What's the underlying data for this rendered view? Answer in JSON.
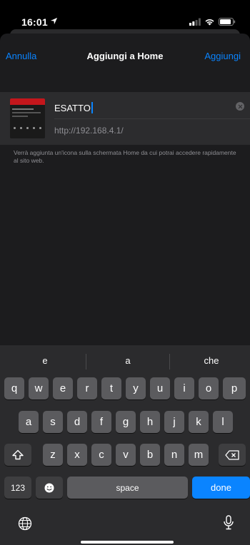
{
  "status_bar": {
    "time": "16:01"
  },
  "nav": {
    "cancel_label": "Annulla",
    "title": "Aggiungi a Home",
    "add_label": "Aggiungi"
  },
  "bookmark": {
    "name_value": "ESATTO",
    "url": "http://192.168.4.1/"
  },
  "hint_text": "Verrà aggiunta un'icona sulla schermata Home da cui potrai accedere rapidamente al sito web.",
  "keyboard": {
    "suggestions": [
      "e",
      "a",
      "che"
    ],
    "row1": [
      "q",
      "w",
      "e",
      "r",
      "t",
      "y",
      "u",
      "i",
      "o",
      "p"
    ],
    "row2": [
      "a",
      "s",
      "d",
      "f",
      "g",
      "h",
      "j",
      "k",
      "l"
    ],
    "row3": [
      "z",
      "x",
      "c",
      "v",
      "b",
      "n",
      "m"
    ],
    "numbers_label": "123",
    "space_label": "space",
    "done_label": "done"
  },
  "colors": {
    "accent": "#0a84ff",
    "sheet_background": "#1c1c1e",
    "keyboard_background": "#2b2b2d"
  },
  "icons": [
    "location-arrow-icon",
    "signal-icon",
    "wifi-icon",
    "battery-icon",
    "clear-icon",
    "shift-icon",
    "backspace-icon",
    "emoji-icon",
    "globe-icon",
    "microphone-icon"
  ]
}
